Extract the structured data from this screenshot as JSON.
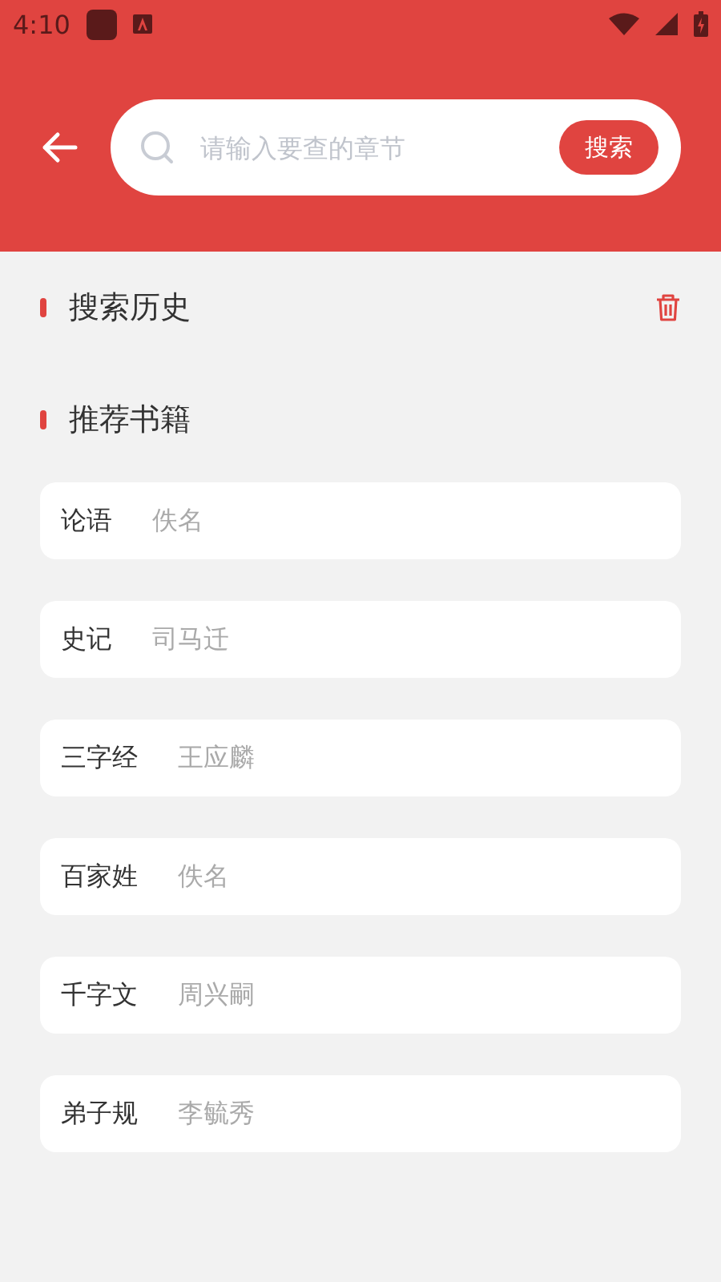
{
  "status_bar": {
    "time": "4:10"
  },
  "header": {
    "search": {
      "placeholder": "请输入要查的章节"
    },
    "search_button": "搜索"
  },
  "sections": [
    {
      "title": "搜索历史",
      "kind": "history"
    },
    {
      "title": "推荐书籍",
      "kind": "books"
    }
  ],
  "books": [
    {
      "title": "论语",
      "author": "佚名"
    },
    {
      "title": "史记",
      "author": "司马迁"
    },
    {
      "title": "三字经",
      "author": "王应麟"
    },
    {
      "title": "百家姓",
      "author": "佚名"
    },
    {
      "title": "千字文",
      "author": "周兴嗣"
    },
    {
      "title": "弟子规",
      "author": "李毓秀"
    }
  ]
}
